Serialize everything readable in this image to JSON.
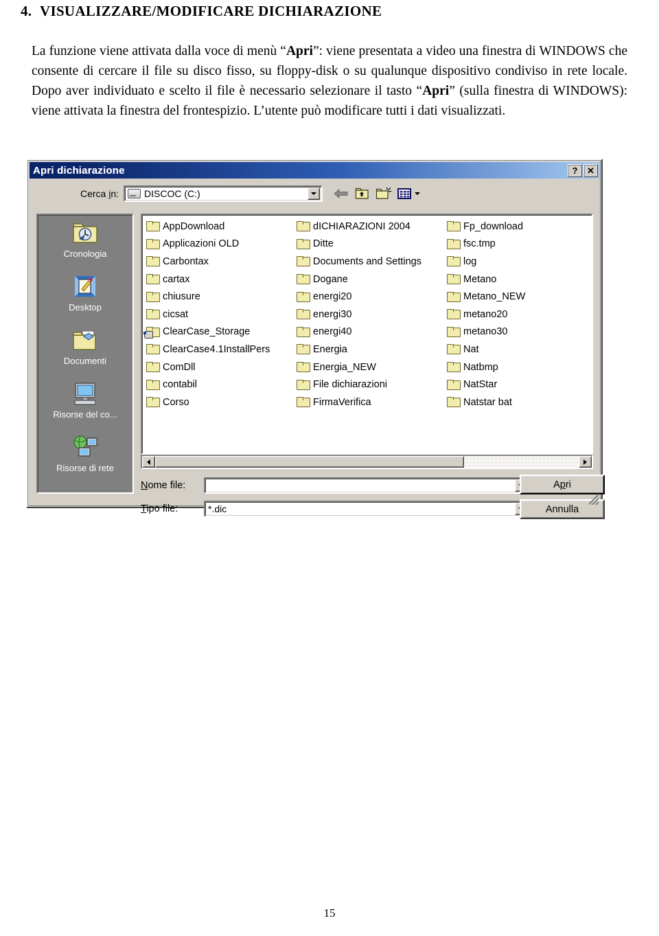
{
  "document": {
    "heading_number": "4.",
    "heading_text": "VISUALIZZARE/MODIFICARE DICHIARAZIONE",
    "paragraph_part1": "La funzione viene attivata dalla voce di menù “",
    "paragraph_bold1": "Apri",
    "paragraph_part2": "”: viene presentata a video una finestra di WINDOWS che consente di cercare il file su disco fisso, su floppy-disk o su qualunque dispositivo condiviso in rete locale. Dopo aver individuato e scelto il file è necessario selezionare il tasto “",
    "paragraph_bold2": "Apri",
    "paragraph_part3": "” (sulla finestra di WINDOWS): viene attivata la finestra del frontespizio. L’utente può modificare tutti i dati visualizzati.",
    "page_number": "15"
  },
  "dialog": {
    "title": "Apri dichiarazione",
    "help_button": "?",
    "close_button": "✕",
    "lookin": {
      "label_pre": "Cerca ",
      "label_underlined": "i",
      "label_post": "n:",
      "value": "DISCOC (C:)"
    },
    "toolbar": {
      "back": "back-arrow",
      "up": "up-one-level",
      "new_folder": "new-folder",
      "views": "views-menu"
    },
    "places": [
      {
        "label": "Cronologia",
        "icon": "history-icon"
      },
      {
        "label": "Desktop",
        "icon": "desktop-icon"
      },
      {
        "label": "Documenti",
        "icon": "documents-icon"
      },
      {
        "label": "Risorse del co...",
        "icon": "my-computer-icon"
      },
      {
        "label": "Risorse di rete",
        "icon": "network-icon"
      }
    ],
    "files": {
      "column1": [
        {
          "name": "AppDownload",
          "shared": false
        },
        {
          "name": "Applicazioni OLD",
          "shared": false
        },
        {
          "name": "Carbontax",
          "shared": false
        },
        {
          "name": "cartax",
          "shared": false
        },
        {
          "name": "chiusure",
          "shared": false
        },
        {
          "name": "cicsat",
          "shared": false
        },
        {
          "name": "ClearCase_Storage",
          "shared": true
        },
        {
          "name": "ClearCase4.1InstallPers",
          "shared": false
        },
        {
          "name": "ComDll",
          "shared": false
        },
        {
          "name": "contabil",
          "shared": false
        },
        {
          "name": "Corso",
          "shared": false
        }
      ],
      "column2": [
        {
          "name": "dICHIARAZIONI 2004",
          "shared": false
        },
        {
          "name": "Ditte",
          "shared": false
        },
        {
          "name": "Documents and Settings",
          "shared": false
        },
        {
          "name": "Dogane",
          "shared": false
        },
        {
          "name": "energi20",
          "shared": false
        },
        {
          "name": "energi30",
          "shared": false
        },
        {
          "name": "energi40",
          "shared": false
        },
        {
          "name": "Energia",
          "shared": false
        },
        {
          "name": "Energia_NEW",
          "shared": false
        },
        {
          "name": "File dichiarazioni",
          "shared": false
        },
        {
          "name": "FirmaVerifica",
          "shared": false
        }
      ],
      "column3": [
        {
          "name": "Fp_download",
          "shared": false
        },
        {
          "name": "fsc.tmp",
          "shared": false
        },
        {
          "name": "log",
          "shared": false
        },
        {
          "name": "Metano",
          "shared": false
        },
        {
          "name": "Metano_NEW",
          "shared": false
        },
        {
          "name": "metano20",
          "shared": false
        },
        {
          "name": "metano30",
          "shared": false
        },
        {
          "name": "Nat",
          "shared": false
        },
        {
          "name": "Natbmp",
          "shared": false
        },
        {
          "name": "NatStar",
          "shared": false
        },
        {
          "name": "Natstar bat",
          "shared": false
        }
      ],
      "column4": [
        {
          "name": "",
          "shared": false
        },
        {
          "name": "",
          "shared": false
        },
        {
          "name": "",
          "shared": false
        },
        {
          "name": "",
          "shared": false
        },
        {
          "name": "",
          "shared": false
        },
        {
          "name": "",
          "shared": false
        },
        {
          "name": "",
          "shared": false
        },
        {
          "name": "",
          "shared": false
        },
        {
          "name": "",
          "shared": false
        },
        {
          "name": "",
          "shared": false
        },
        {
          "name": "",
          "shared": false
        }
      ]
    },
    "fields": {
      "name_label_pre": "",
      "name_label_underlined": "N",
      "name_label_post": "ome file:",
      "name_value": "",
      "type_label_underlined": "T",
      "type_label_post": "ipo file:",
      "type_value": "*.dic"
    },
    "buttons": {
      "open_pre": "A",
      "open_underlined": "p",
      "open_post": "ri",
      "cancel": "Annulla"
    }
  },
  "colors": {
    "titlebar_start": "#0a246a",
    "titlebar_end": "#a6caf0",
    "dialog_face": "#d4d0c8",
    "places_bg": "#808080",
    "folder_fill": "#f2edad"
  }
}
